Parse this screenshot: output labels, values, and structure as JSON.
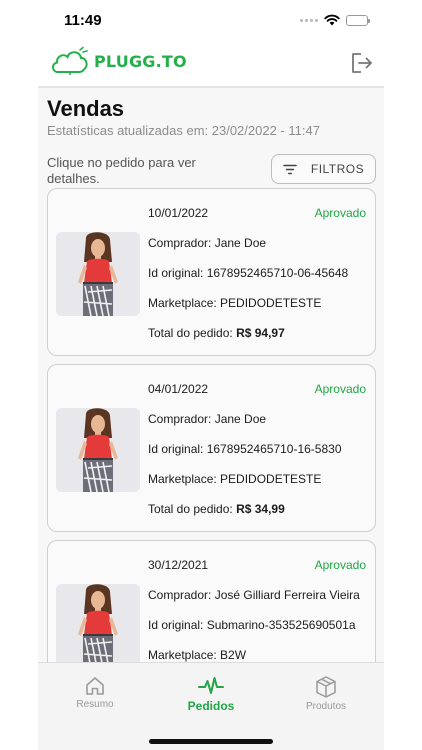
{
  "status_bar": {
    "time": "11:49"
  },
  "header": {
    "logo_text": "PLUGG.TO"
  },
  "page": {
    "title": "Vendas",
    "subtitle": "Estatísticas atualizadas em: 23/02/2022 - 11:47",
    "hint": "Clique no pedido para ver detalhes.",
    "filter_label": "FILTROS"
  },
  "orders": [
    {
      "date": "10/01/2022",
      "status": "Aprovado",
      "buyer": "Comprador: Jane Doe",
      "original_id": "Id original: 1678952465710-06-45648",
      "marketplace": "Marketplace: PEDIDODETESTE",
      "total_label": "Total do pedido:",
      "total_value": "R$ 94,97"
    },
    {
      "date": "04/01/2022",
      "status": "Aprovado",
      "buyer": "Comprador: Jane Doe",
      "original_id": "Id original: 1678952465710-16-5830",
      "marketplace": "Marketplace: PEDIDODETESTE",
      "total_label": "Total do pedido:",
      "total_value": "R$ 34,99"
    },
    {
      "date": "30/12/2021",
      "status": "Aprovado",
      "buyer": "Comprador: José Gilliard Ferreira Vieira",
      "original_id": "Id original: Submarino-353525690501a",
      "marketplace": "Marketplace: B2W"
    }
  ],
  "tabs": [
    {
      "label": "Resumo",
      "icon": "home-icon"
    },
    {
      "label": "Pedidos",
      "icon": "pulse-icon",
      "active": true
    },
    {
      "label": "Produtos",
      "icon": "box-icon"
    }
  ],
  "colors": {
    "brand_green": "#22a447",
    "status_approved": "#22a447"
  }
}
